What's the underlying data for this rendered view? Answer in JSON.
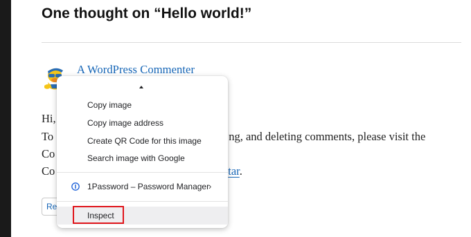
{
  "post": {
    "comments_title": "One thought on “Hello world!”"
  },
  "comment": {
    "author": "A WordPress Commenter",
    "line1": "Hi,",
    "line2_start": "To",
    "line2_end": "ng, and deleting comments, please visit the",
    "line3_start": "Co",
    "line4_start": "Co",
    "line4_link": "tar",
    "line4_end": ".",
    "reply_label": "Re"
  },
  "context_menu": {
    "items": [
      {
        "label": "Copy image"
      },
      {
        "label": "Copy image address"
      },
      {
        "label": "Create QR Code for this image"
      },
      {
        "label": "Search image with Google"
      }
    ],
    "extension": {
      "label": "1Password – Password Manager",
      "icon": "1password-icon",
      "submenu_icon": "chevron-right-icon"
    },
    "inspect": {
      "label": "Inspect"
    }
  },
  "colors": {
    "link": "#1565b6",
    "highlight_box": "#e0141a"
  }
}
